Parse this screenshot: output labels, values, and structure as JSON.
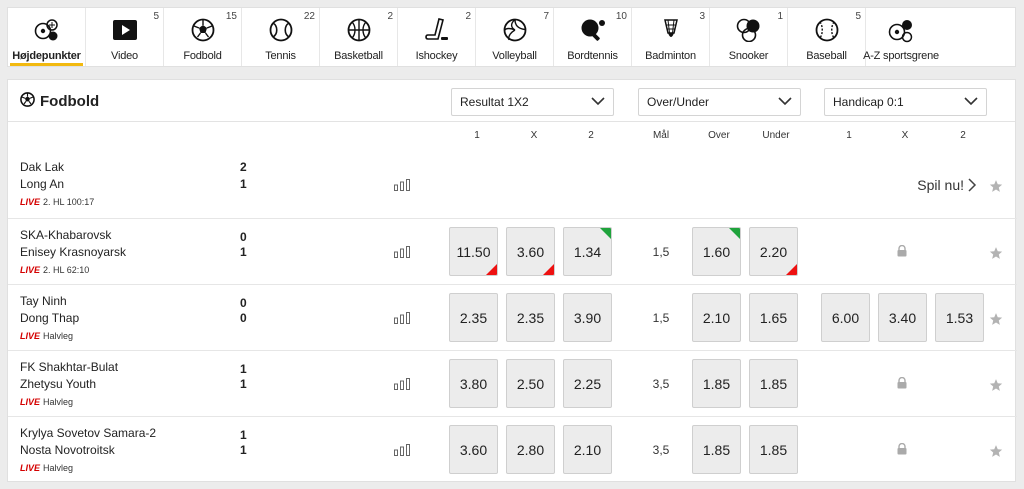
{
  "nav": [
    {
      "label": "Højdepunkter",
      "count": "",
      "icon": "highlights-icon",
      "active": true
    },
    {
      "label": "Video",
      "count": "5",
      "icon": "video-icon"
    },
    {
      "label": "Fodbold",
      "count": "15",
      "icon": "football-icon"
    },
    {
      "label": "Tennis",
      "count": "22",
      "icon": "tennis-icon"
    },
    {
      "label": "Basketball",
      "count": "2",
      "icon": "basketball-icon"
    },
    {
      "label": "Ishockey",
      "count": "2",
      "icon": "icehockey-icon"
    },
    {
      "label": "Volleyball",
      "count": "7",
      "icon": "volleyball-icon"
    },
    {
      "label": "Bordtennis",
      "count": "10",
      "icon": "tabletennis-icon"
    },
    {
      "label": "Badminton",
      "count": "3",
      "icon": "badminton-icon"
    },
    {
      "label": "Snooker",
      "count": "1",
      "icon": "snooker-icon"
    },
    {
      "label": "Baseball",
      "count": "5",
      "icon": "baseball-icon"
    },
    {
      "label": "A-Z sportsgrene",
      "count": "",
      "icon": "all-sports-icon"
    }
  ],
  "panel": {
    "title": "Fodbold",
    "dropdowns": [
      "Resultat 1X2",
      "Over/Under",
      "Handicap 0:1"
    ],
    "columns": {
      "r1": "1",
      "rx": "X",
      "r2": "2",
      "goals": "Mål",
      "over": "Over",
      "under": "Under",
      "h1": "1",
      "hx": "X",
      "h2": "2"
    }
  },
  "matches": [
    {
      "home": "Dak Lak",
      "away": "Long An",
      "home_score": "2",
      "away_score": "1",
      "live": "LIVE",
      "status": "2. HL 100:17",
      "cta": "Spil nu!"
    },
    {
      "home": "SKA-Khabarovsk",
      "away": "Enisey Krasnoyarsk",
      "home_score": "0",
      "away_score": "1",
      "live": "LIVE",
      "status": "2. HL 62:10",
      "odds": [
        "11.50",
        "3.60",
        "1.34"
      ],
      "goals": "1,5",
      "ou": [
        "1.60",
        "2.20"
      ]
    },
    {
      "home": "Tay Ninh",
      "away": "Dong Thap",
      "home_score": "0",
      "away_score": "0",
      "live": "LIVE",
      "status": "Halvleg",
      "odds": [
        "2.35",
        "2.35",
        "3.90"
      ],
      "goals": "1,5",
      "ou": [
        "2.10",
        "1.65"
      ],
      "hcp": [
        "6.00",
        "3.40",
        "1.53"
      ]
    },
    {
      "home": "FK Shakhtar-Bulat",
      "away": "Zhetysu Youth",
      "home_score": "1",
      "away_score": "1",
      "live": "LIVE",
      "status": "Halvleg",
      "odds": [
        "3.80",
        "2.50",
        "2.25"
      ],
      "goals": "3,5",
      "ou": [
        "1.85",
        "1.85"
      ]
    },
    {
      "home": "Krylya Sovetov Samara-2",
      "away": "Nosta Novotroitsk",
      "home_score": "1",
      "away_score": "1",
      "live": "LIVE",
      "status": "Halvleg",
      "odds": [
        "3.60",
        "2.80",
        "2.10"
      ],
      "goals": "3,5",
      "ou": [
        "1.85",
        "1.85"
      ]
    }
  ],
  "colors": {
    "accent": "#f2b90f",
    "live": "#d40000",
    "odds_down": "#e11111",
    "odds_up": "#1fa33c"
  }
}
